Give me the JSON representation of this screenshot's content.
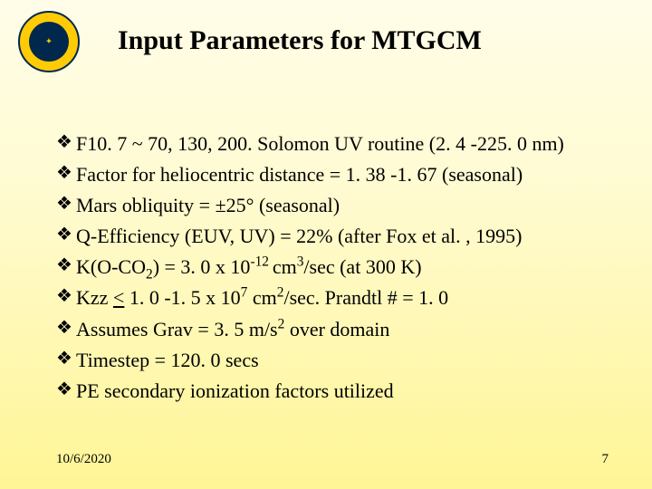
{
  "title": "Input Parameters for MTGCM",
  "logo": {
    "name": "university-seal",
    "outer_color": "#ffcb05",
    "inner_color": "#00274c"
  },
  "bullets": [
    {
      "marker": "❖",
      "pre": "F10. 7 ~ 70, 130, 200. Solomon UV routine (2. 4 -225. 0 nm)"
    },
    {
      "marker": "❖",
      "pre": "Factor for heliocentric distance = 1. 38 -1. 67 (seasonal)"
    },
    {
      "marker": "❖",
      "pre": "Mars obliquity =  ±25°  (seasonal)"
    },
    {
      "marker": "❖",
      "pre": "Q-Efficiency (EUV, UV) = 22% (after Fox et al. , 1995)"
    },
    {
      "marker": "❖",
      "pre": "K(O-CO",
      "sub1": "2",
      "mid1": ") = 3. 0 x 10",
      "sup1": "-12 ",
      "mid2": "cm",
      "sup2": "3",
      "post": "/sec  (at 300 K)"
    },
    {
      "marker": "❖",
      "pre": "Kzz ",
      "u": "<",
      "mid1": " 1. 0 -1. 5 x 10",
      "sup1": "7",
      "mid2": " cm",
      "sup2": "2",
      "post": "/sec. Prandtl # = 1. 0"
    },
    {
      "marker": "❖",
      "pre": "Assumes Grav = 3. 5 m/s",
      "sup1": "2",
      "post": " over domain"
    },
    {
      "marker": "❖",
      "pre": "Timestep = 120. 0 secs"
    },
    {
      "marker": "❖",
      "pre": "PE secondary ionization factors utilized"
    }
  ],
  "footer": {
    "date": "10/6/2020",
    "page": "7"
  }
}
